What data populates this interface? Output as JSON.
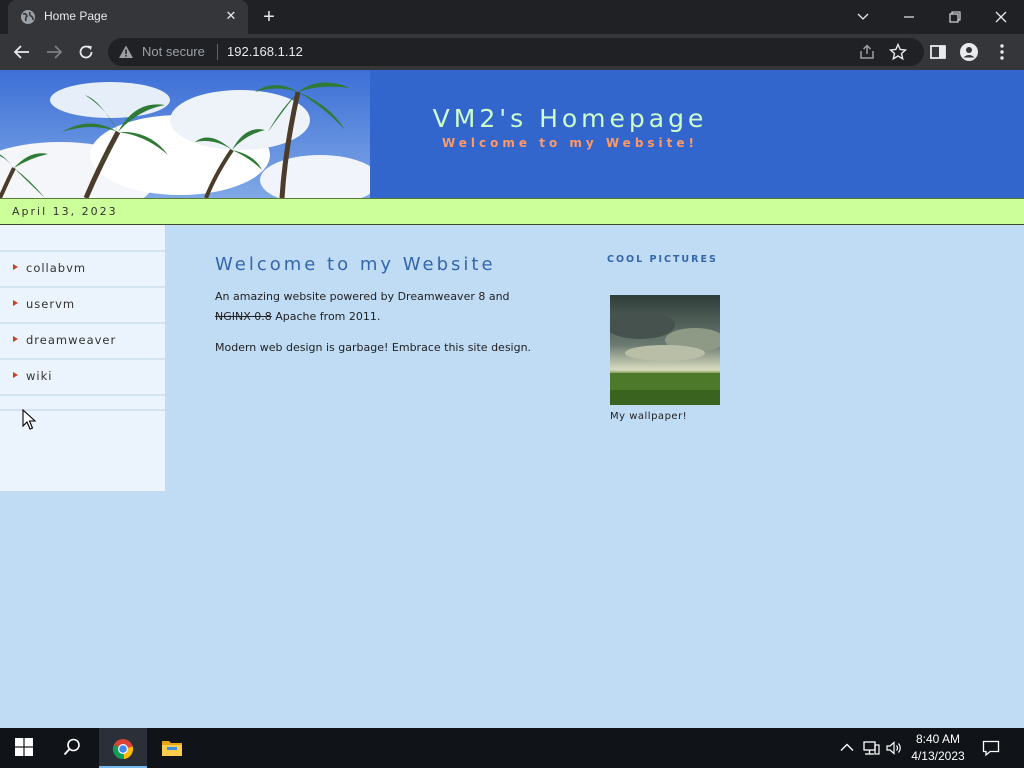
{
  "browser": {
    "tab_title": "Home Page",
    "security_label": "Not secure",
    "url": "192.168.1.12"
  },
  "site": {
    "title": "VM2's Homepage",
    "subtitle": "Welcome to my Website!",
    "date": "April 13, 2023",
    "nav": [
      {
        "label": "collabvm"
      },
      {
        "label": "uservm"
      },
      {
        "label": "dreamweaver"
      },
      {
        "label": "wiki"
      }
    ],
    "main": {
      "heading": "Welcome to my Website",
      "para1_lead": "An amazing website powered by Dreamweaver 8 and",
      "para1_struck": "NGINX 0.8",
      "para1_tail": "Apache from 2011.",
      "para2": "Modern web design is garbage! Embrace this site design."
    },
    "sidebar_right": {
      "heading": "COOL PICTURES",
      "caption": "My wallpaper!"
    }
  },
  "taskbar": {
    "time": "8:40 AM",
    "date": "4/13/2023"
  },
  "colors": {
    "header_bg": "#3366cc",
    "title": "#ccffcc",
    "subtitle": "#ff9966",
    "date_bar": "#ccff99",
    "page_bg": "#c0dcf4",
    "sidebar_bg": "#ebf4fd",
    "nav_arrow": "#d43c1e",
    "heading": "#3366aa"
  }
}
